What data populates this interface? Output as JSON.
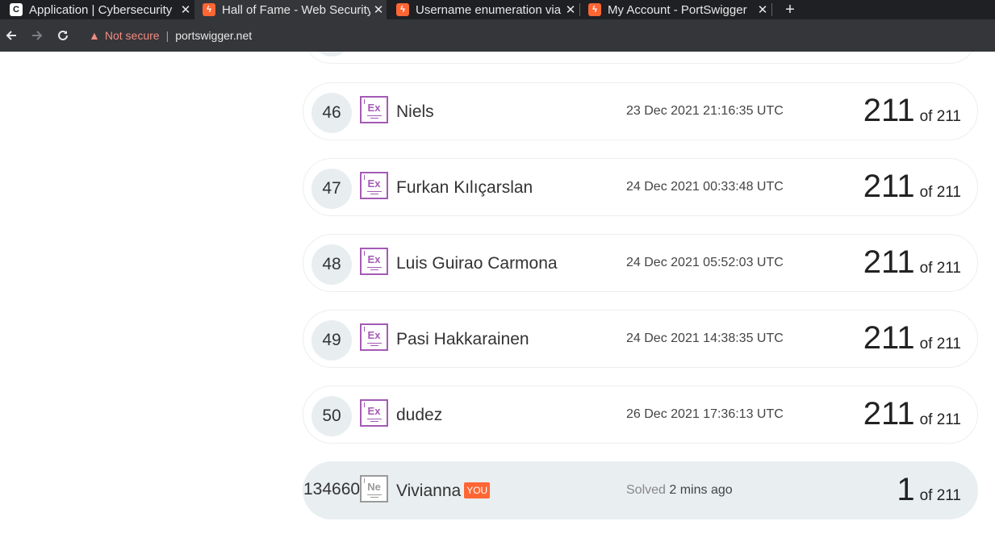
{
  "browser": {
    "tabs": [
      {
        "title": "Application | Cybersecurity",
        "favicon": "cybersecurity-c-icon",
        "active": false
      },
      {
        "title": "Hall of Fame - Web Security",
        "favicon": "portswigger-icon",
        "active": true
      },
      {
        "title": "Username enumeration via",
        "favicon": "portswigger-icon",
        "active": false
      },
      {
        "title": "My Account - PortSwigger",
        "favicon": "portswigger-icon",
        "active": false
      }
    ],
    "new_tab": "+",
    "close_glyph": "✕",
    "security_label": "Not secure",
    "url": "portswigger.net"
  },
  "leaderboard": {
    "rows": [
      {
        "rank": "46",
        "badge": "Ex",
        "name": "Niels",
        "date": "23 Dec 2021 21:16:35 UTC",
        "score": "211",
        "total": "of 211"
      },
      {
        "rank": "47",
        "badge": "Ex",
        "name": "Furkan Kılıçarslan",
        "date": "24 Dec 2021 00:33:48 UTC",
        "score": "211",
        "total": "of 211"
      },
      {
        "rank": "48",
        "badge": "Ex",
        "name": "Luis Guirao Carmona",
        "date": "24 Dec 2021 05:52:03 UTC",
        "score": "211",
        "total": "of 211"
      },
      {
        "rank": "49",
        "badge": "Ex",
        "name": "Pasi Hakkarainen",
        "date": "24 Dec 2021 14:38:35 UTC",
        "score": "211",
        "total": "of 211"
      },
      {
        "rank": "50",
        "badge": "Ex",
        "name": "dudez",
        "date": "26 Dec 2021 17:36:13 UTC",
        "score": "211",
        "total": "of 211"
      }
    ],
    "you": {
      "rank": "134660",
      "badge": "Ne",
      "name": "Vivianna",
      "tag": "YOU",
      "solved_label": "Solved",
      "solved_time": "2 mins ago",
      "score": "1",
      "total": "of 211"
    }
  },
  "colors": {
    "accent": "#ff6633",
    "expert_badge": "#a45ab5",
    "novice_badge": "#9a9a9a"
  }
}
